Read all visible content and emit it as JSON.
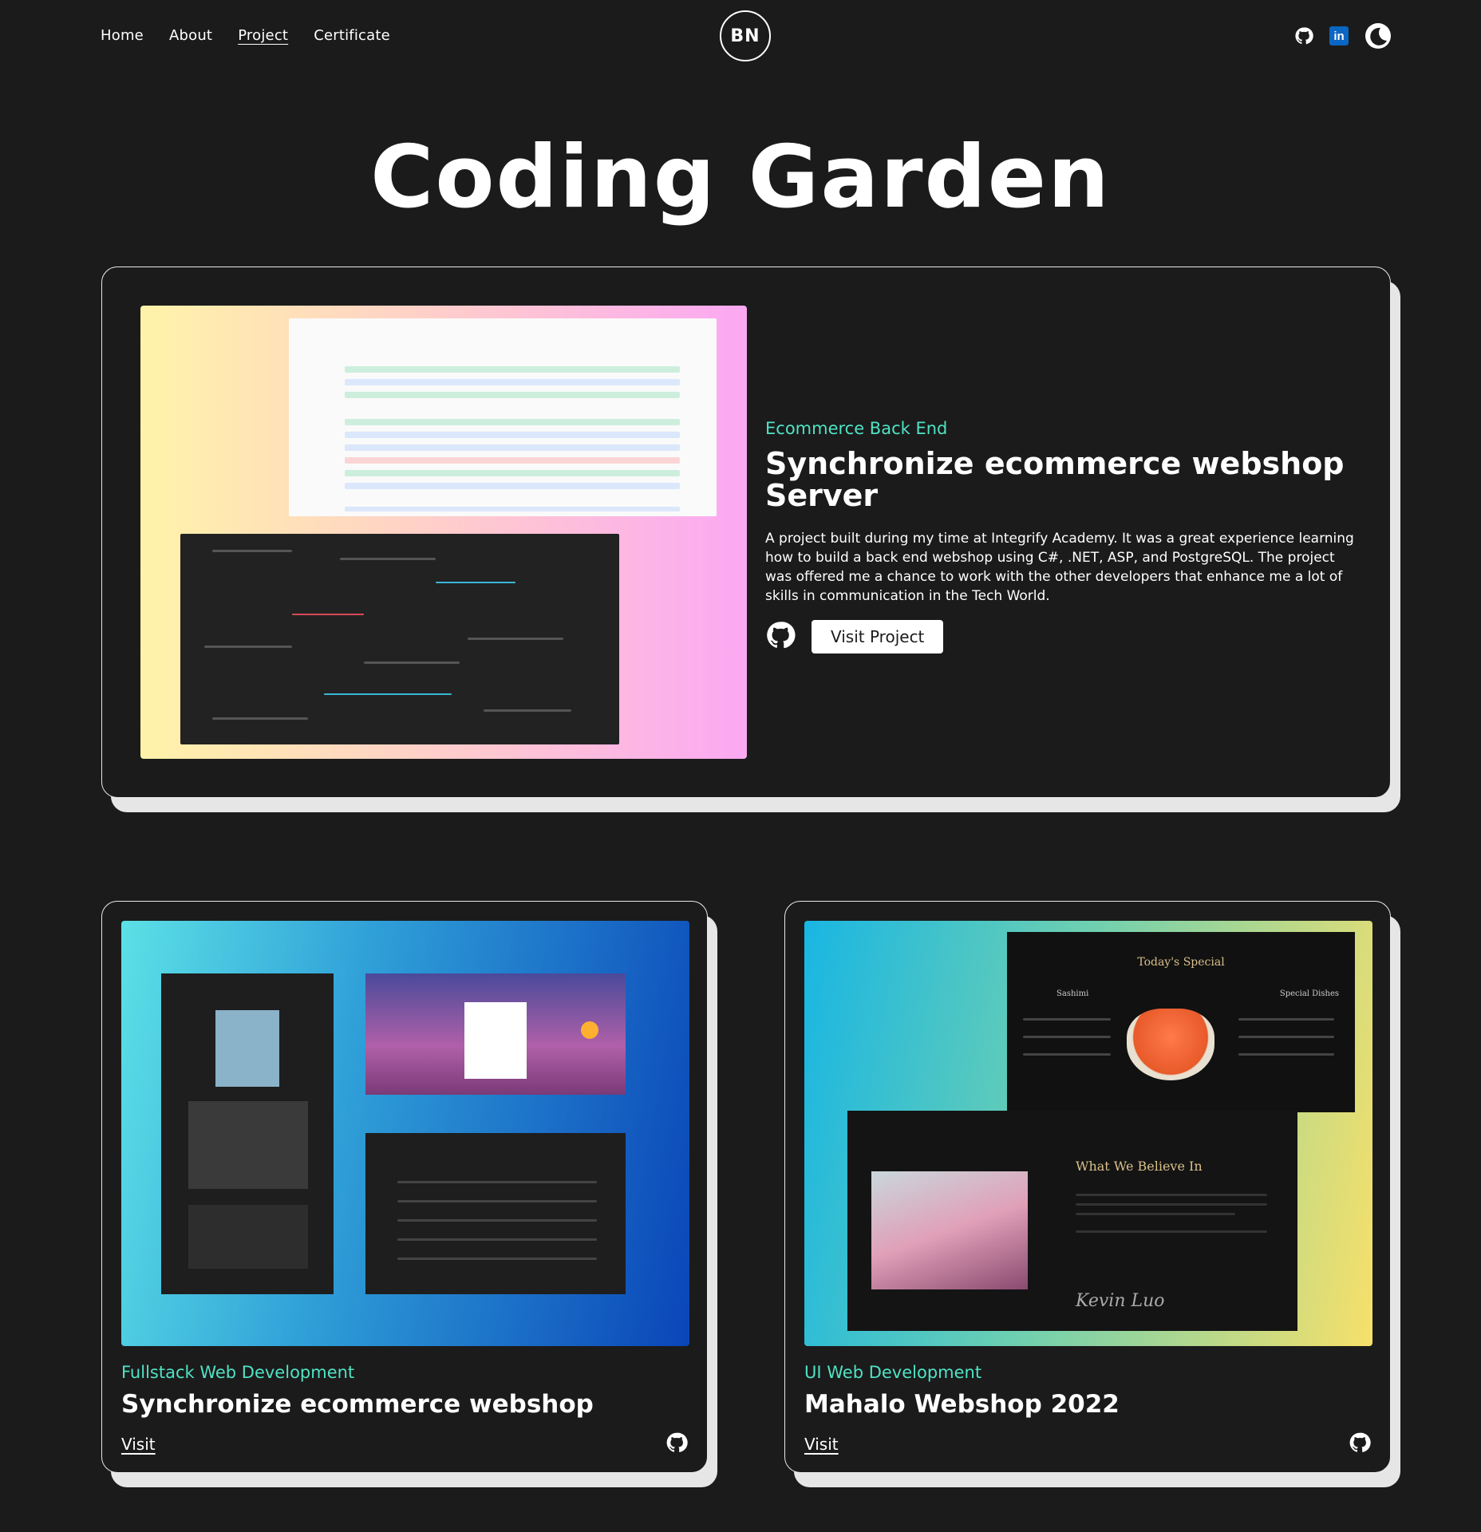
{
  "nav": {
    "items": [
      "Home",
      "About",
      "Project",
      "Certificate"
    ],
    "active": "Project"
  },
  "logo": {
    "initials": "BN"
  },
  "social": [
    "github-icon",
    "linkedin-icon",
    "theme-toggle-icon"
  ],
  "linkedin_label": "in",
  "page": {
    "title": "Coding Garden"
  },
  "featured": {
    "tag": "Ecommerce Back End",
    "title": "Synchronize ecommerce webshop Server",
    "description": "A project built during my time at Integrify Academy. It was a great experience learning how to build a back end webshop using C#, .NET, ASP, and PostgreSQL. The project was offered me a chance to work with the other developers that enhance me a lot of skills in communication in the Tech World.",
    "button": "Visit Project"
  },
  "projects": [
    {
      "tag": "Fullstack Web Development",
      "title": "Synchronize ecommerce webshop",
      "link": "Visit"
    },
    {
      "tag": "UI Web Development",
      "title": "Mahalo Webshop 2022",
      "link": "Visit"
    }
  ],
  "screens": {
    "menu_heading": "Today's Special",
    "menu_col_left": "Sashimi",
    "menu_col_right": "Special Dishes",
    "about_heading": "What We Believe In",
    "signature": "Kevin Luo"
  },
  "colors": {
    "accent": "#4fe3c4",
    "background": "#1b1b1b",
    "card_border": "#e9e9e9"
  }
}
